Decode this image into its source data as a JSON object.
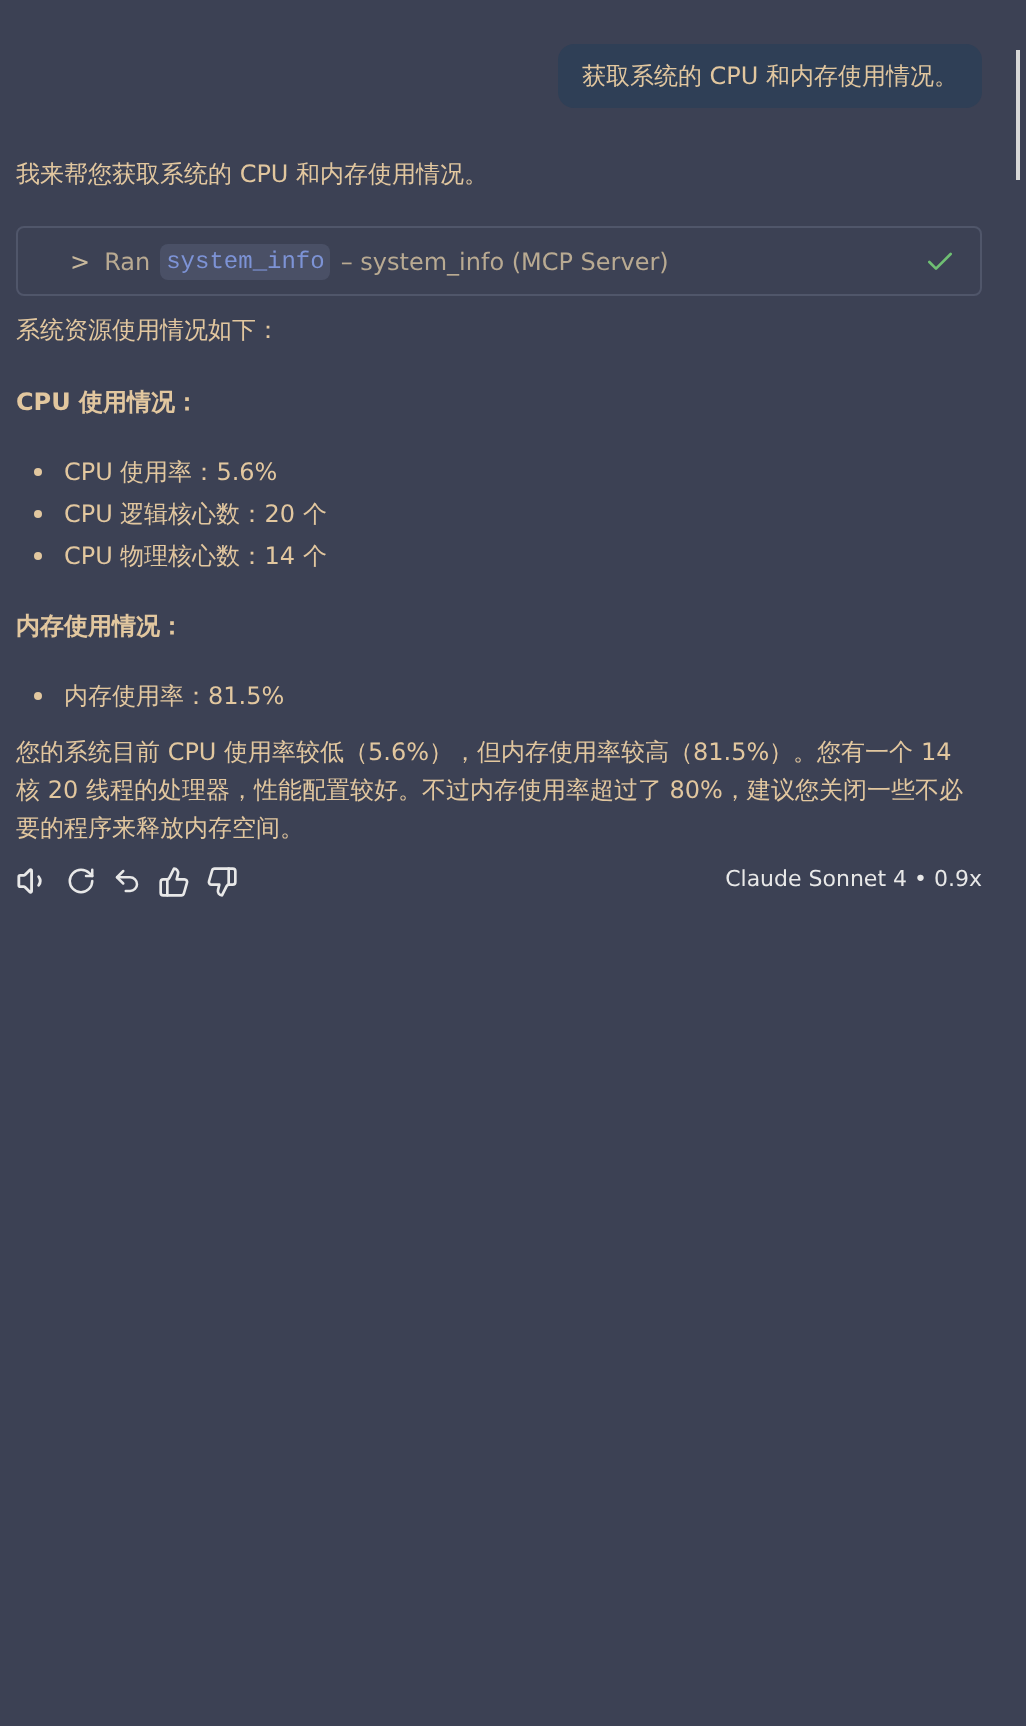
{
  "user_message": "获取系统的 CPU 和内存使用情况。",
  "assistant": {
    "intro": "我来帮您获取系统的 CPU 和内存使用情况。",
    "tool_call": {
      "chevron": ">",
      "verb": "Ran",
      "tool": "system_info",
      "description": "– system_info (MCP Server)",
      "expanded": false,
      "succeeded": true
    },
    "blocks": [
      {
        "kind": "paragraph",
        "text": "系统资源使用情况如下："
      },
      {
        "kind": "heading",
        "text": "CPU 使用情况："
      },
      {
        "kind": "list",
        "items": [
          "CPU 使用率：5.6%",
          "CPU 逻辑核心数：20 个",
          "CPU 物理核心数：14 个"
        ]
      },
      {
        "kind": "heading",
        "text": "内存使用情况："
      },
      {
        "kind": "list",
        "items": [
          "内存使用率：81.5%"
        ]
      },
      {
        "kind": "paragraph",
        "text": "您的系统目前 CPU 使用率较低（5.6%），但内存使用率较高（81.5%）。您有一个 14 核 20 线程的处理器，性能配置较好。不过内存使用率超过了 80%，建议您关闭一些不必要的程序来释放内存空间。"
      }
    ],
    "model": "Claude Sonnet 4 • 0.9x"
  }
}
